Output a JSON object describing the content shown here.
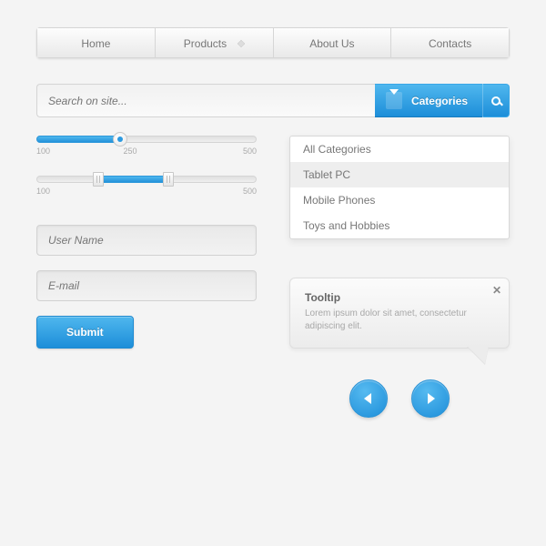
{
  "nav": {
    "items": [
      {
        "label": "Home"
      },
      {
        "label": "Products",
        "has_indicator": true
      },
      {
        "label": "About Us"
      },
      {
        "label": "Contacts"
      }
    ]
  },
  "search": {
    "placeholder": "Search on site...",
    "categories_label": "Categories"
  },
  "dropdown": {
    "items": [
      {
        "label": "All Categories",
        "selected": false
      },
      {
        "label": "Tablet PC",
        "selected": true
      },
      {
        "label": "Mobile Phones",
        "selected": false
      },
      {
        "label": "Toys and Hobbies",
        "selected": false
      }
    ]
  },
  "slider1": {
    "min_label": "100",
    "mid_label": "250",
    "max_label": "500",
    "value_pct": 38
  },
  "slider2": {
    "min_label": "100",
    "max_label": "500",
    "low_pct": 28,
    "high_pct": 60
  },
  "inputs": {
    "username_placeholder": "User Name",
    "email_placeholder": "E-mail"
  },
  "submit_label": "Submit",
  "tooltip": {
    "title": "Tooltip",
    "body": "Lorem ipsum dolor sit amet, consectetur adipiscing elit."
  },
  "colors": {
    "accent": "#2d9ae0"
  }
}
